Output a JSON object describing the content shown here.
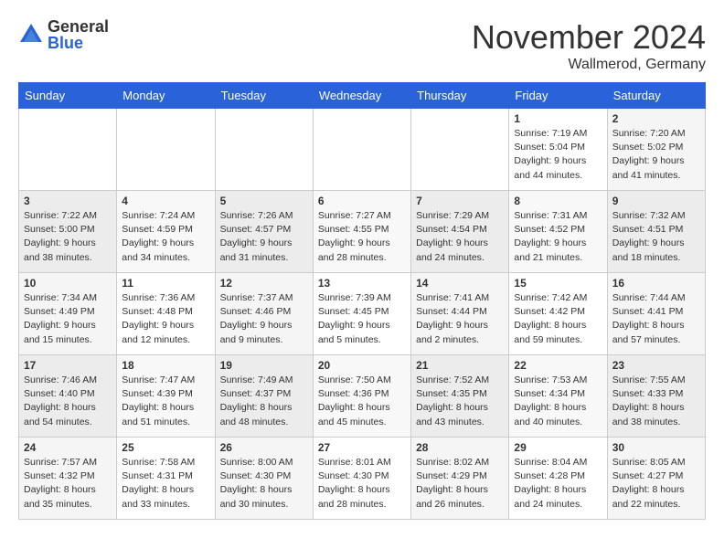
{
  "header": {
    "logo": {
      "general": "General",
      "blue": "Blue"
    },
    "title": "November 2024",
    "location": "Wallmerod, Germany"
  },
  "weekdays": [
    "Sunday",
    "Monday",
    "Tuesday",
    "Wednesday",
    "Thursday",
    "Friday",
    "Saturday"
  ],
  "weeks": [
    [
      {
        "day": "",
        "info": ""
      },
      {
        "day": "",
        "info": ""
      },
      {
        "day": "",
        "info": ""
      },
      {
        "day": "",
        "info": ""
      },
      {
        "day": "",
        "info": ""
      },
      {
        "day": "1",
        "info": "Sunrise: 7:19 AM\nSunset: 5:04 PM\nDaylight: 9 hours and 44 minutes."
      },
      {
        "day": "2",
        "info": "Sunrise: 7:20 AM\nSunset: 5:02 PM\nDaylight: 9 hours and 41 minutes."
      }
    ],
    [
      {
        "day": "3",
        "info": "Sunrise: 7:22 AM\nSunset: 5:00 PM\nDaylight: 9 hours and 38 minutes."
      },
      {
        "day": "4",
        "info": "Sunrise: 7:24 AM\nSunset: 4:59 PM\nDaylight: 9 hours and 34 minutes."
      },
      {
        "day": "5",
        "info": "Sunrise: 7:26 AM\nSunset: 4:57 PM\nDaylight: 9 hours and 31 minutes."
      },
      {
        "day": "6",
        "info": "Sunrise: 7:27 AM\nSunset: 4:55 PM\nDaylight: 9 hours and 28 minutes."
      },
      {
        "day": "7",
        "info": "Sunrise: 7:29 AM\nSunset: 4:54 PM\nDaylight: 9 hours and 24 minutes."
      },
      {
        "day": "8",
        "info": "Sunrise: 7:31 AM\nSunset: 4:52 PM\nDaylight: 9 hours and 21 minutes."
      },
      {
        "day": "9",
        "info": "Sunrise: 7:32 AM\nSunset: 4:51 PM\nDaylight: 9 hours and 18 minutes."
      }
    ],
    [
      {
        "day": "10",
        "info": "Sunrise: 7:34 AM\nSunset: 4:49 PM\nDaylight: 9 hours and 15 minutes."
      },
      {
        "day": "11",
        "info": "Sunrise: 7:36 AM\nSunset: 4:48 PM\nDaylight: 9 hours and 12 minutes."
      },
      {
        "day": "12",
        "info": "Sunrise: 7:37 AM\nSunset: 4:46 PM\nDaylight: 9 hours and 9 minutes."
      },
      {
        "day": "13",
        "info": "Sunrise: 7:39 AM\nSunset: 4:45 PM\nDaylight: 9 hours and 5 minutes."
      },
      {
        "day": "14",
        "info": "Sunrise: 7:41 AM\nSunset: 4:44 PM\nDaylight: 9 hours and 2 minutes."
      },
      {
        "day": "15",
        "info": "Sunrise: 7:42 AM\nSunset: 4:42 PM\nDaylight: 8 hours and 59 minutes."
      },
      {
        "day": "16",
        "info": "Sunrise: 7:44 AM\nSunset: 4:41 PM\nDaylight: 8 hours and 57 minutes."
      }
    ],
    [
      {
        "day": "17",
        "info": "Sunrise: 7:46 AM\nSunset: 4:40 PM\nDaylight: 8 hours and 54 minutes."
      },
      {
        "day": "18",
        "info": "Sunrise: 7:47 AM\nSunset: 4:39 PM\nDaylight: 8 hours and 51 minutes."
      },
      {
        "day": "19",
        "info": "Sunrise: 7:49 AM\nSunset: 4:37 PM\nDaylight: 8 hours and 48 minutes."
      },
      {
        "day": "20",
        "info": "Sunrise: 7:50 AM\nSunset: 4:36 PM\nDaylight: 8 hours and 45 minutes."
      },
      {
        "day": "21",
        "info": "Sunrise: 7:52 AM\nSunset: 4:35 PM\nDaylight: 8 hours and 43 minutes."
      },
      {
        "day": "22",
        "info": "Sunrise: 7:53 AM\nSunset: 4:34 PM\nDaylight: 8 hours and 40 minutes."
      },
      {
        "day": "23",
        "info": "Sunrise: 7:55 AM\nSunset: 4:33 PM\nDaylight: 8 hours and 38 minutes."
      }
    ],
    [
      {
        "day": "24",
        "info": "Sunrise: 7:57 AM\nSunset: 4:32 PM\nDaylight: 8 hours and 35 minutes."
      },
      {
        "day": "25",
        "info": "Sunrise: 7:58 AM\nSunset: 4:31 PM\nDaylight: 8 hours and 33 minutes."
      },
      {
        "day": "26",
        "info": "Sunrise: 8:00 AM\nSunset: 4:30 PM\nDaylight: 8 hours and 30 minutes."
      },
      {
        "day": "27",
        "info": "Sunrise: 8:01 AM\nSunset: 4:30 PM\nDaylight: 8 hours and 28 minutes."
      },
      {
        "day": "28",
        "info": "Sunrise: 8:02 AM\nSunset: 4:29 PM\nDaylight: 8 hours and 26 minutes."
      },
      {
        "day": "29",
        "info": "Sunrise: 8:04 AM\nSunset: 4:28 PM\nDaylight: 8 hours and 24 minutes."
      },
      {
        "day": "30",
        "info": "Sunrise: 8:05 AM\nSunset: 4:27 PM\nDaylight: 8 hours and 22 minutes."
      }
    ]
  ]
}
